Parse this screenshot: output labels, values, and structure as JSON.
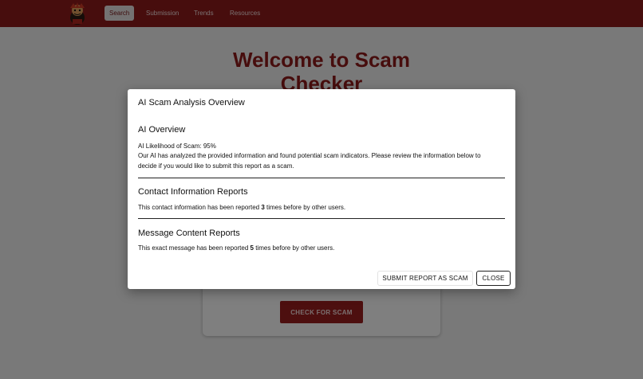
{
  "nav": {
    "items": [
      {
        "label": "Search",
        "active": true
      },
      {
        "label": "Submission"
      },
      {
        "label": "Trends"
      },
      {
        "label": "Resources"
      }
    ]
  },
  "main": {
    "title_line1": "Welcome to Scam",
    "title_line2": "Checker",
    "check_button": "CHECK FOR SCAM"
  },
  "modal": {
    "title": "AI Scam Analysis Overview",
    "ai_overview": {
      "heading": "AI Overview",
      "likelihood": "AI Likelihood of Scam: 95%",
      "description": "Our AI has analyzed the provided information and found potential scam indicators. Please review the information below to decide if you would like to submit this report as a scam."
    },
    "contact_reports": {
      "heading": "Contact Information Reports",
      "text_before": "This contact information has been reported ",
      "count": "3",
      "text_after": " times before by other users."
    },
    "message_reports": {
      "heading": "Message Content Reports",
      "text_before": "This exact message has been reported ",
      "count": "5",
      "text_after": " times before by other users."
    },
    "submit_button": "SUBMIT REPORT AS SCAM",
    "close_button": "CLOSE"
  },
  "colors": {
    "brand": "#8e1b1b",
    "button": "#9a1f1f"
  },
  "icons": {
    "logo": "mascot-logo-icon"
  }
}
